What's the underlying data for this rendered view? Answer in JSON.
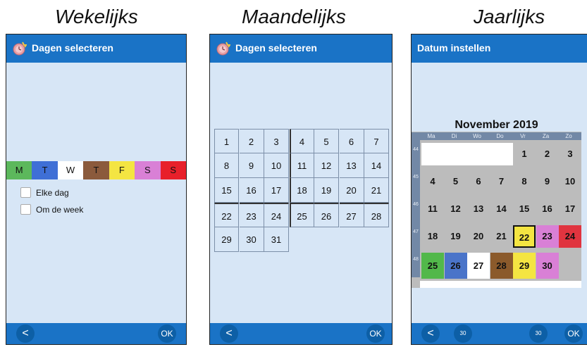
{
  "captions": {
    "weekly": "Wekelijks",
    "monthly": "Maandelijks",
    "yearly": "Jaarlijks"
  },
  "weekly": {
    "title": "Dagen selecteren",
    "days": [
      {
        "label": "M",
        "color": "#5cb85c"
      },
      {
        "label": "T",
        "color": "#3f6fd6"
      },
      {
        "label": "W",
        "color": "#ffffff"
      },
      {
        "label": "T",
        "color": "#8b5a3c"
      },
      {
        "label": "F",
        "color": "#f4e542"
      },
      {
        "label": "S",
        "color": "#d980d6"
      },
      {
        "label": "S",
        "color": "#e8202a"
      }
    ],
    "options": [
      "Elke dag",
      "Om de week"
    ],
    "back": "<",
    "ok": "OK"
  },
  "monthly": {
    "title": "Dagen selecteren",
    "days": [
      "1",
      "2",
      "3",
      "4",
      "5",
      "6",
      "7",
      "8",
      "9",
      "10",
      "11",
      "12",
      "13",
      "14",
      "15",
      "16",
      "17",
      "18",
      "19",
      "20",
      "21",
      "22",
      "23",
      "24",
      "25",
      "26",
      "27",
      "28",
      "29",
      "30",
      "31"
    ],
    "back": "<",
    "ok": "OK"
  },
  "yearly": {
    "title": "Datum instellen",
    "month": "November 2019",
    "weekdays": [
      "Ma",
      "Di",
      "Wo",
      "Do",
      "Vr",
      "Za",
      "Zo"
    ],
    "weeks": [
      "44",
      "45",
      "46",
      "47",
      "48"
    ],
    "days": [
      {
        "d": "1",
        "color": "#bcbcbc"
      },
      {
        "d": "2",
        "color": "#bcbcbc"
      },
      {
        "d": "3",
        "color": "#bcbcbc"
      },
      {
        "d": "4",
        "color": "#bcbcbc"
      },
      {
        "d": "5",
        "color": "#bcbcbc"
      },
      {
        "d": "6",
        "color": "#bcbcbc"
      },
      {
        "d": "7",
        "color": "#bcbcbc"
      },
      {
        "d": "8",
        "color": "#bcbcbc"
      },
      {
        "d": "9",
        "color": "#bcbcbc"
      },
      {
        "d": "10",
        "color": "#bcbcbc"
      },
      {
        "d": "11",
        "color": "#bcbcbc"
      },
      {
        "d": "12",
        "color": "#bcbcbc"
      },
      {
        "d": "13",
        "color": "#bcbcbc"
      },
      {
        "d": "14",
        "color": "#bcbcbc"
      },
      {
        "d": "15",
        "color": "#bcbcbc"
      },
      {
        "d": "16",
        "color": "#bcbcbc"
      },
      {
        "d": "17",
        "color": "#bcbcbc"
      },
      {
        "d": "18",
        "color": "#bcbcbc"
      },
      {
        "d": "19",
        "color": "#bcbcbc"
      },
      {
        "d": "20",
        "color": "#bcbcbc"
      },
      {
        "d": "21",
        "color": "#bcbcbc"
      },
      {
        "d": "22",
        "color": "#f4e542",
        "selected": true
      },
      {
        "d": "23",
        "color": "#d980d6"
      },
      {
        "d": "24",
        "color": "#e0343f"
      },
      {
        "d": "25",
        "color": "#52b84a"
      },
      {
        "d": "26",
        "color": "#4a74c9"
      },
      {
        "d": "27",
        "color": "#ffffff"
      },
      {
        "d": "28",
        "color": "#8b5a2b"
      },
      {
        "d": "29",
        "color": "#f4e542"
      },
      {
        "d": "30",
        "color": "#d980d6"
      }
    ],
    "prev_label": "30",
    "next_label": "30",
    "back": "<",
    "ok": "OK"
  }
}
